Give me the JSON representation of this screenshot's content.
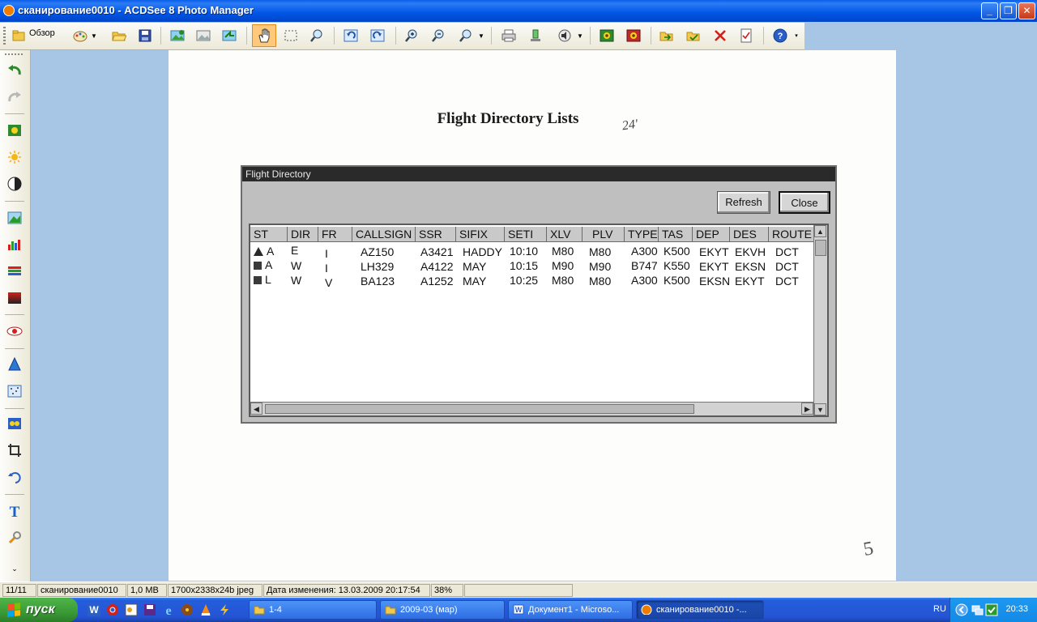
{
  "window": {
    "title": "сканирование0010 - ACDSee 8 Photo Manager",
    "minimize_glyph": "_",
    "restore_glyph": "❐",
    "close_glyph": "✕"
  },
  "toolbar": {
    "browse_label": "Обзор"
  },
  "document": {
    "heading": "Flight Directory Lists",
    "handwriting": "24'",
    "corner_mark": "5"
  },
  "dialog": {
    "title": "Flight Directory",
    "refresh_label": "Refresh",
    "close_label": "Close",
    "columns": [
      "ST",
      "DIR",
      "FR",
      "CALLSIGN",
      "SSR",
      "SIFIX",
      "SETI",
      "XLV",
      "PLV",
      "TYPE",
      "TAS",
      "DEP",
      "DES",
      "ROUTE"
    ],
    "rows": [
      {
        "st_icon": "triangle",
        "st": "A",
        "dir": "E",
        "fr": "I",
        "callsign": "AZ150",
        "ssr": "A3421",
        "sifix": "HADDY",
        "seti": "10:10",
        "xlv": "M80",
        "plv": "M80",
        "type": "A300",
        "tas": "K500",
        "dep": "EKYT",
        "des": "EKVH",
        "route": "DCT"
      },
      {
        "st_icon": "square",
        "st": "A",
        "dir": "W",
        "fr": "I",
        "callsign": "LH329",
        "ssr": "A4122",
        "sifix": "MAY",
        "seti": "10:15",
        "xlv": "M90",
        "plv": "M90",
        "type": "B747",
        "tas": "K550",
        "dep": "EKYT",
        "des": "EKSN",
        "route": "DCT"
      },
      {
        "st_icon": "square",
        "st": "L",
        "dir": "W",
        "fr": "V",
        "callsign": "BA123",
        "ssr": "A1252",
        "sifix": "MAY",
        "seti": "10:25",
        "xlv": "M80",
        "plv": "M80",
        "type": "A300",
        "tas": "K500",
        "dep": "EKSN",
        "des": "EKYT",
        "route": "DCT"
      }
    ]
  },
  "statusbar": {
    "index": "11/11",
    "filename": "сканирование0010",
    "size": "1,0 MB",
    "dimensions": "1700x2338x24b jpeg",
    "modified": "Дата изменения: 13.03.2009 20:17:54",
    "zoom": "38%"
  },
  "taskbar": {
    "start_label": "пуск",
    "tasks": [
      {
        "label": "1-4",
        "icon": "folder-icon"
      },
      {
        "label": "2009-03 (мар)",
        "icon": "folder-icon"
      },
      {
        "label": "Документ1 - Microso...",
        "icon": "word-icon"
      },
      {
        "label": "сканирование0010 -...",
        "icon": "acdsee-icon"
      }
    ],
    "language": "RU",
    "clock": "20:33"
  },
  "colors": {
    "titlebar": "#0055e5",
    "viewer_bg": "#a7c6e6",
    "taskbar": "#245edc",
    "start_button": "#3a9a35"
  }
}
